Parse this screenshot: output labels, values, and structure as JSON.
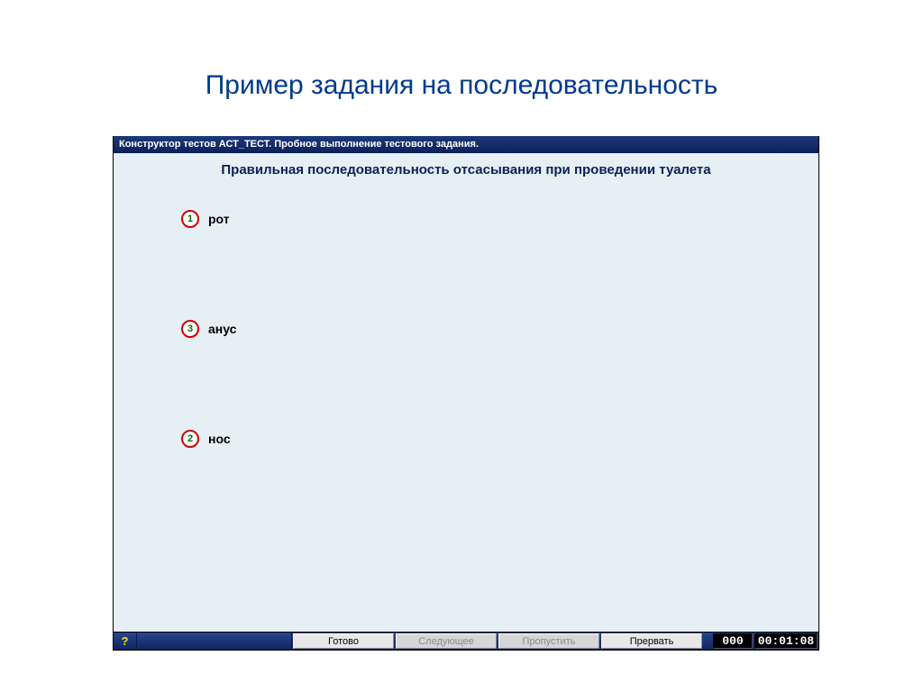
{
  "slide": {
    "title": "Пример задания на последовательность"
  },
  "window": {
    "titlebar": "Конструктор тестов АСТ_ТЕСТ. Пробное выполнение тестового задания.",
    "question": "Правильная последовательность отсасывания при проведении туалета"
  },
  "items": [
    {
      "number": "1",
      "label": "рот"
    },
    {
      "number": "3",
      "label": "анус"
    },
    {
      "number": "2",
      "label": "нос"
    }
  ],
  "statusbar": {
    "help": "?",
    "buttons": {
      "ready": "Готово",
      "next": "Следующее",
      "skip": "Пропустить",
      "abort": "Прервать"
    },
    "counter": "000",
    "timer": "00:01:08"
  }
}
